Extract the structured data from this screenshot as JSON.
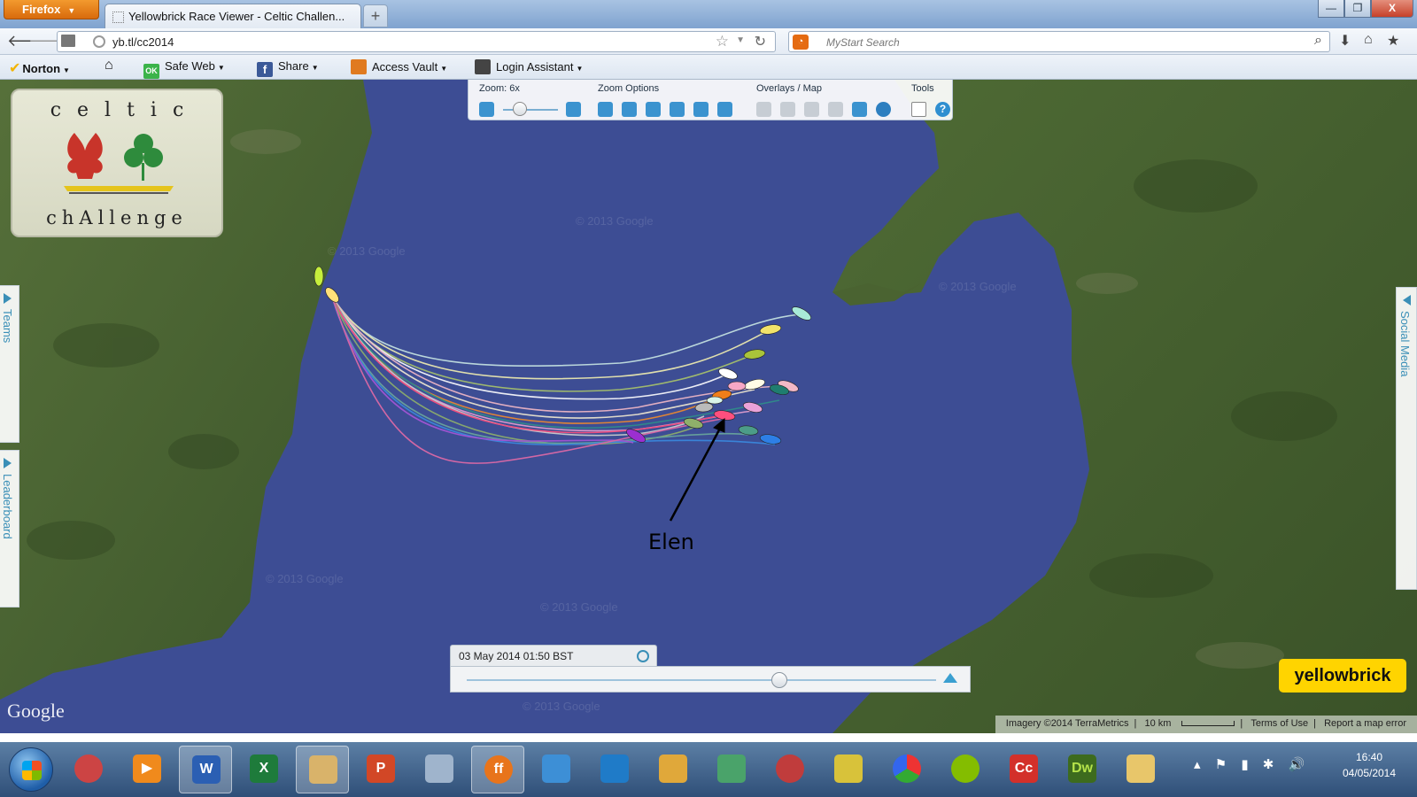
{
  "browser": {
    "menu_label": "Firefox",
    "tab_title": "Yellowbrick Race Viewer - Celtic Challen...",
    "new_tab": "+",
    "url": "yb.tl/cc2014",
    "search_placeholder": "MyStart Search",
    "window_controls": [
      "—",
      "❐",
      "X"
    ]
  },
  "toolbar": {
    "norton": "Norton",
    "safe_web": "Safe Web",
    "share": "Share",
    "access_vault": "Access Vault",
    "login_assistant": "Login Assistant",
    "safe_web_badge": "OK",
    "share_badge": "f"
  },
  "map": {
    "logo_top": "celtic",
    "logo_bottom": "chAllenge",
    "controls": {
      "zoom_label": "Zoom: 6x",
      "zoom_options": "Zoom Options",
      "overlays": "Overlays / Map",
      "tools": "Tools"
    },
    "side_tabs": {
      "teams": "Teams",
      "leaderboard": "Leaderboard",
      "social": "Social Media"
    },
    "timestamp": "03 May 2014 01:50 BST",
    "annotation": "Elen",
    "brand": "yellowbrick",
    "google": "Google",
    "attribution": {
      "imagery": "Imagery ©2014 TerraMetrics",
      "scale": "10 km",
      "terms": "Terms of Use",
      "report": "Report a map error"
    },
    "watermark": "© 2013 Google",
    "colors": {
      "sea": "#3d4d94",
      "land": "#3f5a2e",
      "accent": "#3a8fb7",
      "brand": "#ffd400"
    }
  },
  "taskbar": {
    "apps": [
      "snipping-tool",
      "media-player",
      "word",
      "excel",
      "explorer-window",
      "powerpoint",
      "calculator",
      "firefox",
      "control-panel",
      "remote-desktop",
      "user-folder",
      "network",
      "bug-app",
      "tools-app",
      "picasa",
      "spotify",
      "creative-cloud",
      "dreamweaver",
      "libraries"
    ],
    "app_badges": {
      "word": "W",
      "excel": "X",
      "powerpoint": "P",
      "firefox": "ff",
      "dreamweaver": "Dw",
      "creative-cloud": "Cc"
    },
    "time": "16:40",
    "date": "04/05/2014",
    "tray_icons": [
      "▴",
      "⚑",
      "▮",
      "✱",
      "🔊"
    ]
  }
}
